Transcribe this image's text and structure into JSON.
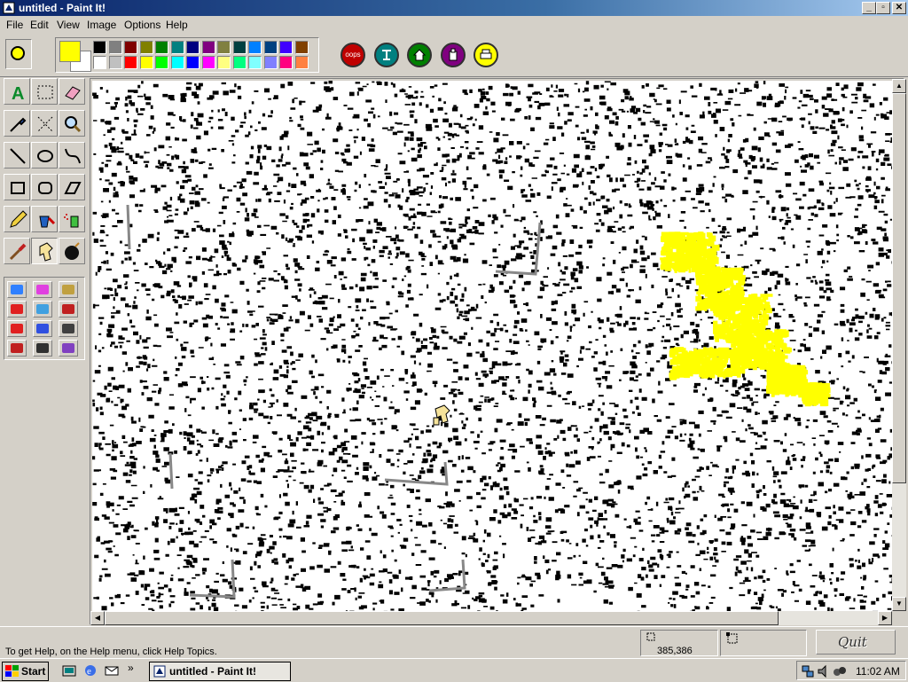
{
  "window": {
    "title": "untitled - Paint It!",
    "controls": {
      "minimize": "_",
      "maximize": "▫",
      "close": "✕"
    }
  },
  "menu": [
    "File",
    "Edit",
    "View",
    "Image",
    "Options",
    "Help"
  ],
  "palette": {
    "current_foreground": "#ffff00",
    "current_background": "#ffffff",
    "colors_row1": [
      "#000000",
      "#808080",
      "#800000",
      "#808000",
      "#008000",
      "#008080",
      "#000080",
      "#800080",
      "#808040",
      "#004040",
      "#0080ff",
      "#004080",
      "#4000ff",
      "#804000"
    ],
    "colors_row2": [
      "#ffffff",
      "#c0c0c0",
      "#ff0000",
      "#ffff00",
      "#00ff00",
      "#00ffff",
      "#0000ff",
      "#ff00ff",
      "#ffff80",
      "#00ff80",
      "#80ffff",
      "#8080ff",
      "#ff0080",
      "#ff8040"
    ]
  },
  "action_buttons": [
    {
      "name": "oops",
      "label": "oops",
      "color": "#c00000"
    },
    {
      "name": "clear",
      "label": "",
      "color": "#008080"
    },
    {
      "name": "home",
      "label": "",
      "color": "#008000"
    },
    {
      "name": "save",
      "label": "",
      "color": "#800080"
    },
    {
      "name": "print",
      "label": "",
      "color": "#ffff00"
    }
  ],
  "tools": [
    "text-tool",
    "rect-select-tool",
    "eraser-tool",
    "dropper-tool",
    "free-select-tool",
    "zoom-tool",
    "line-tool",
    "ellipse-tool",
    "curve-tool",
    "rectangle-tool",
    "rounded-rect-tool",
    "polygon-tool",
    "pencil-tool",
    "fill-bucket-tool",
    "spray-tool",
    "brush-tool",
    "stamp-tool",
    "bomb-tool"
  ],
  "selected_tool": "stamp-tool",
  "canvas": {
    "paint_color": "#ffff00",
    "ink_color": "#000000",
    "stroke_color": "#888888"
  },
  "status": {
    "help_text": "To get Help, on the Help menu, click Help Topics.",
    "coords": "385,386",
    "quit_label": "Quit"
  },
  "taskbar": {
    "start_label": "Start",
    "task_label": "untitled - Paint It!",
    "clock": "11:02 AM"
  }
}
